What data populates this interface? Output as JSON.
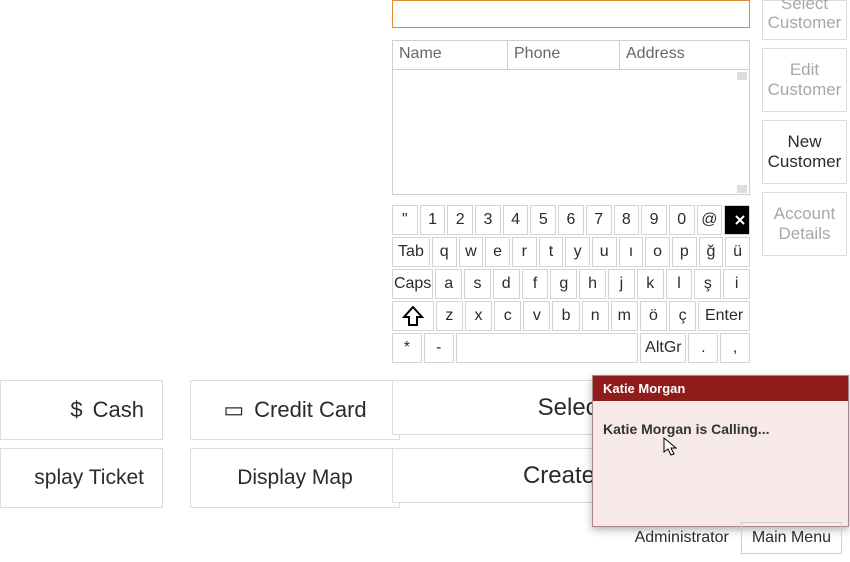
{
  "search": {
    "placeholder": ""
  },
  "table": {
    "cols": [
      "Name",
      "Phone",
      "Address"
    ]
  },
  "side": {
    "select": "Select Customer",
    "edit": "Edit Customer",
    "newc": "New Customer",
    "account": "Account Details"
  },
  "keyboard": {
    "r1": [
      "\"",
      "1",
      "2",
      "3",
      "4",
      "5",
      "6",
      "7",
      "8",
      "9",
      "0",
      "@"
    ],
    "r2_tab": "Tab",
    "r2": [
      "q",
      "w",
      "e",
      "r",
      "t",
      "y",
      "u",
      "ı",
      "o",
      "p",
      "ğ",
      "ü"
    ],
    "r3_caps": "Caps",
    "r3": [
      "a",
      "s",
      "d",
      "f",
      "g",
      "h",
      "j",
      "k",
      "l",
      "ş",
      "i"
    ],
    "r4": [
      "z",
      "x",
      "c",
      "v",
      "b",
      "n",
      "m",
      "ö",
      "ç"
    ],
    "r4_enter": "Enter",
    "r5_star": "*",
    "r5_dash": "-",
    "r5_altgr": "AltGr",
    "r5_dot": ".",
    "r5_comma": ","
  },
  "buttons": {
    "cash": "Cash",
    "credit": "Credit Card",
    "display_ticket": "splay Ticket",
    "display_map": "Display Map",
    "select_customer": "Select",
    "create_new_customer": "Create N"
  },
  "popup": {
    "title": "Katie Morgan",
    "message": "Katie Morgan is Calling..."
  },
  "footer": {
    "user": "Administrator",
    "main_menu": "Main Menu"
  }
}
